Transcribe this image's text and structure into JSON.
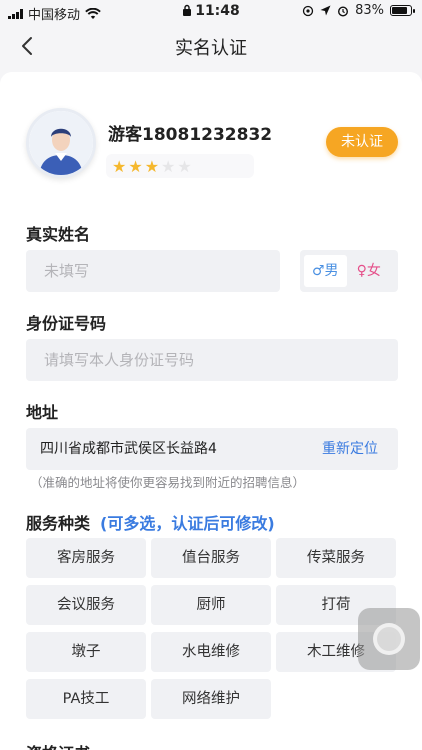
{
  "status": {
    "carrier": "中国移动",
    "time": "11:48",
    "battery": "83%",
    "battery_level": 0.83
  },
  "header": {
    "title": "实名认证",
    "back_icon": "chevron-left-icon"
  },
  "profile": {
    "name": "游客18081232832",
    "rating": 3,
    "rating_max": 5,
    "status_badge": "未认证"
  },
  "form": {
    "name_label": "真实姓名",
    "name_placeholder": "未填写",
    "gender_male": "♂男",
    "gender_female": "♀女",
    "gender_selected": "male",
    "id_label": "身份证号码",
    "id_placeholder": "请填写本人身份证号码",
    "address_label": "地址",
    "address_value": "四川省成都市武侯区长益路4",
    "relocate": "重新定位",
    "address_hint": "（准确的地址将使你更容易找到附近的招聘信息）"
  },
  "services": {
    "label": "服务种类",
    "sub_label": "(可多选，认证后可修改)",
    "items": [
      "客房服务",
      "值台服务",
      "传菜服务",
      "会议服务",
      "厨师",
      "打荷",
      "墩子",
      "水电维修",
      "木工维修",
      "PA技工",
      "网络维护"
    ]
  },
  "next_section_label": "资格证书",
  "colors": {
    "accent_orange": "#f6a623",
    "accent_blue": "#3a7be0",
    "star_active": "#f5b82e",
    "female_pink": "#e5508a"
  }
}
